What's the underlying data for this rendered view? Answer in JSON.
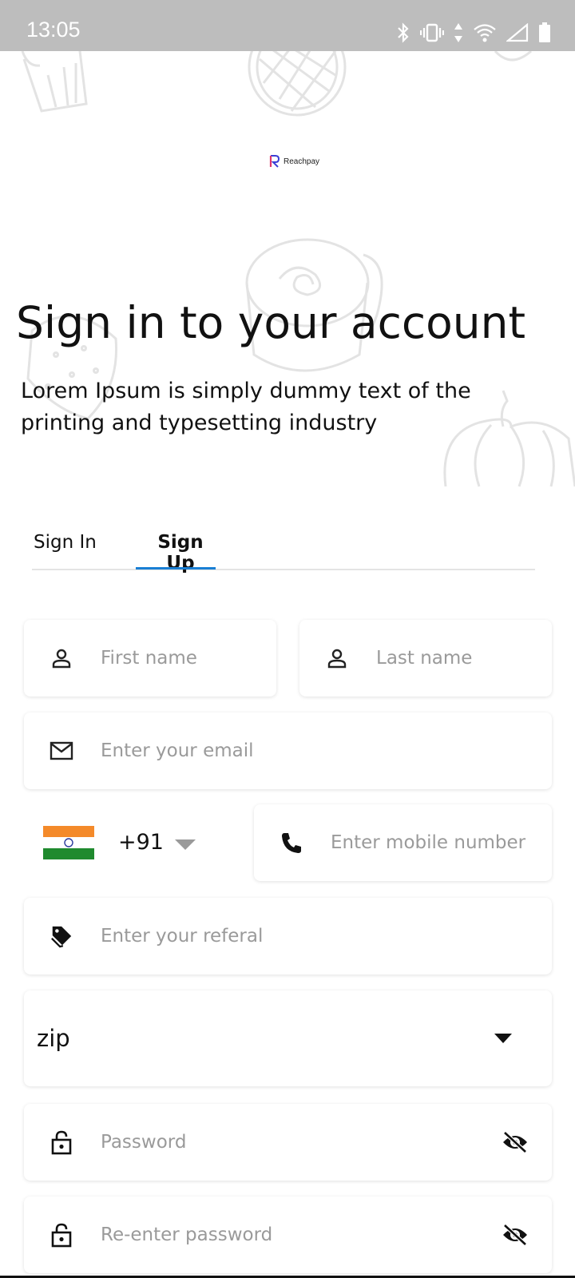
{
  "status_bar": {
    "time": "13:05",
    "icons": [
      "bluetooth-icon",
      "vibrate-icon",
      "data-arrows-icon",
      "wifi-icon",
      "signal-icon",
      "battery-icon"
    ]
  },
  "logo": {
    "text": "Reachpay"
  },
  "heading": "Sign in to your account",
  "subtext": "Lorem Ipsum is simply dummy text of the printing and typesetting industry",
  "tabs": [
    {
      "label": "Sign In",
      "active": false
    },
    {
      "label": "Sign Up",
      "active": true
    }
  ],
  "colors": {
    "accent": "#1a7fd4",
    "placeholder": "#9a9a9a",
    "status_bar": "#bdbdbd"
  },
  "form": {
    "first_name": {
      "placeholder": "First name",
      "icon": "person-icon"
    },
    "last_name": {
      "placeholder": "Last name",
      "icon": "person-icon"
    },
    "email": {
      "placeholder": "Enter your email",
      "icon": "mail-icon"
    },
    "country": {
      "flag": "india-flag-icon",
      "dial_code": "+91"
    },
    "mobile": {
      "placeholder": "Enter mobile number",
      "icon": "phone-icon"
    },
    "referral": {
      "placeholder": "Enter your referal",
      "icon": "tag-icon"
    },
    "zip": {
      "value": "zip"
    },
    "password": {
      "placeholder": "Password",
      "icon": "lock-icon"
    },
    "confirm_password": {
      "placeholder": "Re-enter password",
      "icon": "lock-icon"
    }
  }
}
